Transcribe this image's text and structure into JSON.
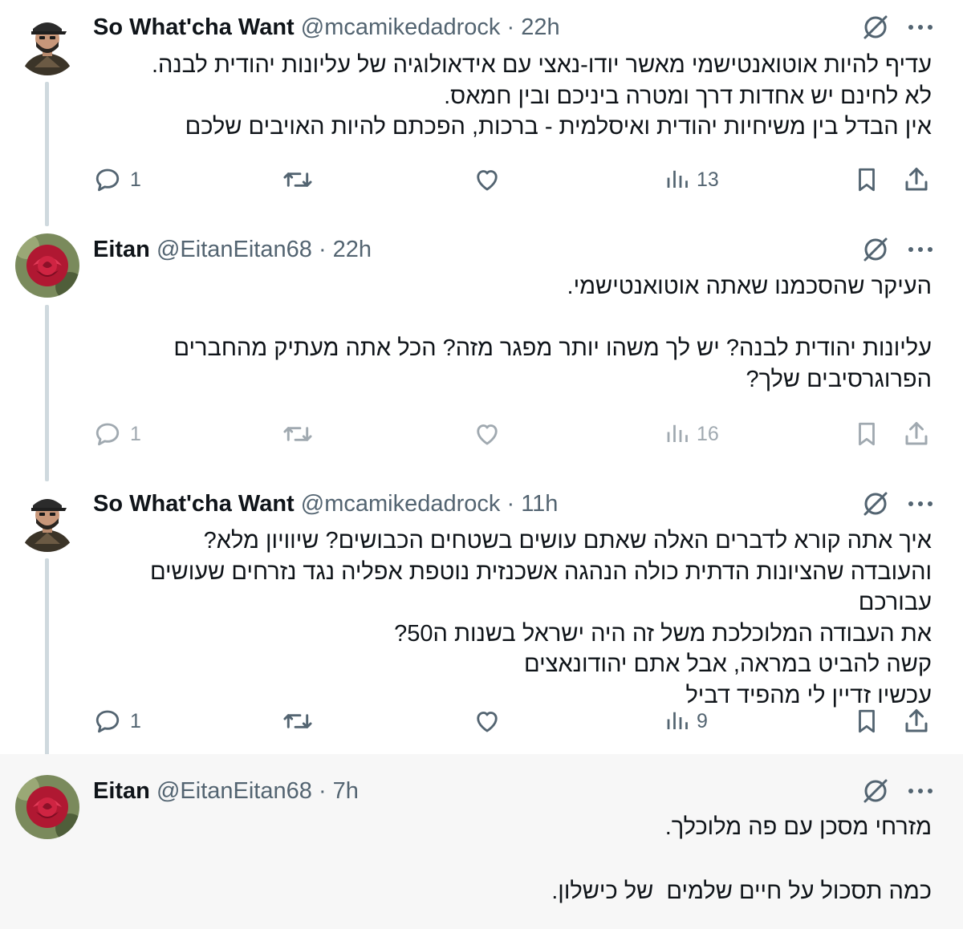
{
  "tweets": [
    {
      "name": "So What'cha Want",
      "handle": "@mcamikedadrock",
      "dot": "·",
      "time": "22h",
      "avatar": "man-with-cap-avatar",
      "lines": [
        "עדיף להיות אוטואנטישמי מאשר יודו-נאצי עם אידאולוגיה של עליונות יהודית לבנה.",
        "לא לחינם יש אחדות דרך ומטרה ביניכם ובין חמאס.",
        "אין הבדל בין משיחיות יהודית ואיסלמית - ברכות, הפכתם להיות האויבים שלכם"
      ],
      "replies": "1",
      "views": "13"
    },
    {
      "name": "Eitan",
      "handle": "@EitanEitan68",
      "dot": "·",
      "time": "22h",
      "avatar": "red-rose-avatar",
      "lines": [
        "העיקר שהסכמנו שאתה אוטואנטישמי.",
        "",
        "עליונות יהודית לבנה? יש לך משהו יותר מפגר מזה? הכל אתה מעתיק מהחברים",
        "הפרוגרסיבים שלך?"
      ],
      "replies": "1",
      "views": "16"
    },
    {
      "name": "So What'cha Want",
      "handle": "@mcamikedadrock",
      "dot": "·",
      "time": "11h",
      "avatar": "man-with-cap-avatar",
      "lines": [
        "איך אתה קורא לדברים האלה שאתם עושים בשטחים הכבושים? שיוויון מלא?",
        "והעובדה שהציונות הדתית כולה הנהגה אשכנזית נוטפת אפליה נגד נזרחים שעושים עבורכם",
        "את העבודה המלוכלכת משל זה היה ישראל בשנות ה50?",
        "קשה להביט במראה, אבל אתם יהודונאצים",
        "עכשיו זדיין לי מהפיד דביל"
      ],
      "replies": "1",
      "views": "9"
    },
    {
      "name": "Eitan",
      "handle": "@EitanEitan68",
      "dot": "·",
      "time": "7h",
      "avatar": "red-rose-avatar",
      "lines": [
        "מזרחי מסכן עם פה מלוכלך.",
        "",
        "כמה תסכול על חיים שלמים  של כישלון."
      ]
    }
  ]
}
